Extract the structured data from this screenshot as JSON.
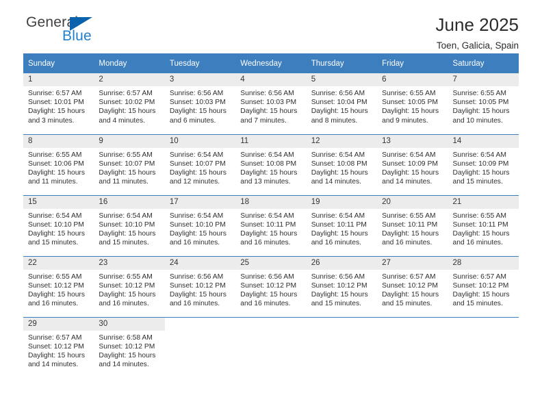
{
  "logo": {
    "primary_text": "General",
    "secondary_text": "Blue",
    "primary_color": "#404040",
    "secondary_color": "#1f7fd0",
    "triangle_color": "#0a62ad",
    "icon": "triangle-icon"
  },
  "header": {
    "title": "June 2025",
    "subtitle": "Toen, Galicia, Spain"
  },
  "theme": {
    "header_bg": "#3d7ebe",
    "header_text": "#ffffff",
    "daynum_bg": "#ececec",
    "divider": "#3d7ebe"
  },
  "calendar": {
    "weekday_headers": [
      "Sunday",
      "Monday",
      "Tuesday",
      "Wednesday",
      "Thursday",
      "Friday",
      "Saturday"
    ],
    "weeks": [
      [
        {
          "day": "1",
          "sunrise": "Sunrise: 6:57 AM",
          "sunset": "Sunset: 10:01 PM",
          "daylight": "Daylight: 15 hours and 3 minutes."
        },
        {
          "day": "2",
          "sunrise": "Sunrise: 6:57 AM",
          "sunset": "Sunset: 10:02 PM",
          "daylight": "Daylight: 15 hours and 4 minutes."
        },
        {
          "day": "3",
          "sunrise": "Sunrise: 6:56 AM",
          "sunset": "Sunset: 10:03 PM",
          "daylight": "Daylight: 15 hours and 6 minutes."
        },
        {
          "day": "4",
          "sunrise": "Sunrise: 6:56 AM",
          "sunset": "Sunset: 10:03 PM",
          "daylight": "Daylight: 15 hours and 7 minutes."
        },
        {
          "day": "5",
          "sunrise": "Sunrise: 6:56 AM",
          "sunset": "Sunset: 10:04 PM",
          "daylight": "Daylight: 15 hours and 8 minutes."
        },
        {
          "day": "6",
          "sunrise": "Sunrise: 6:55 AM",
          "sunset": "Sunset: 10:05 PM",
          "daylight": "Daylight: 15 hours and 9 minutes."
        },
        {
          "day": "7",
          "sunrise": "Sunrise: 6:55 AM",
          "sunset": "Sunset: 10:05 PM",
          "daylight": "Daylight: 15 hours and 10 minutes."
        }
      ],
      [
        {
          "day": "8",
          "sunrise": "Sunrise: 6:55 AM",
          "sunset": "Sunset: 10:06 PM",
          "daylight": "Daylight: 15 hours and 11 minutes."
        },
        {
          "day": "9",
          "sunrise": "Sunrise: 6:55 AM",
          "sunset": "Sunset: 10:07 PM",
          "daylight": "Daylight: 15 hours and 11 minutes."
        },
        {
          "day": "10",
          "sunrise": "Sunrise: 6:54 AM",
          "sunset": "Sunset: 10:07 PM",
          "daylight": "Daylight: 15 hours and 12 minutes."
        },
        {
          "day": "11",
          "sunrise": "Sunrise: 6:54 AM",
          "sunset": "Sunset: 10:08 PM",
          "daylight": "Daylight: 15 hours and 13 minutes."
        },
        {
          "day": "12",
          "sunrise": "Sunrise: 6:54 AM",
          "sunset": "Sunset: 10:08 PM",
          "daylight": "Daylight: 15 hours and 14 minutes."
        },
        {
          "day": "13",
          "sunrise": "Sunrise: 6:54 AM",
          "sunset": "Sunset: 10:09 PM",
          "daylight": "Daylight: 15 hours and 14 minutes."
        },
        {
          "day": "14",
          "sunrise": "Sunrise: 6:54 AM",
          "sunset": "Sunset: 10:09 PM",
          "daylight": "Daylight: 15 hours and 15 minutes."
        }
      ],
      [
        {
          "day": "15",
          "sunrise": "Sunrise: 6:54 AM",
          "sunset": "Sunset: 10:10 PM",
          "daylight": "Daylight: 15 hours and 15 minutes."
        },
        {
          "day": "16",
          "sunrise": "Sunrise: 6:54 AM",
          "sunset": "Sunset: 10:10 PM",
          "daylight": "Daylight: 15 hours and 15 minutes."
        },
        {
          "day": "17",
          "sunrise": "Sunrise: 6:54 AM",
          "sunset": "Sunset: 10:10 PM",
          "daylight": "Daylight: 15 hours and 16 minutes."
        },
        {
          "day": "18",
          "sunrise": "Sunrise: 6:54 AM",
          "sunset": "Sunset: 10:11 PM",
          "daylight": "Daylight: 15 hours and 16 minutes."
        },
        {
          "day": "19",
          "sunrise": "Sunrise: 6:54 AM",
          "sunset": "Sunset: 10:11 PM",
          "daylight": "Daylight: 15 hours and 16 minutes."
        },
        {
          "day": "20",
          "sunrise": "Sunrise: 6:55 AM",
          "sunset": "Sunset: 10:11 PM",
          "daylight": "Daylight: 15 hours and 16 minutes."
        },
        {
          "day": "21",
          "sunrise": "Sunrise: 6:55 AM",
          "sunset": "Sunset: 10:11 PM",
          "daylight": "Daylight: 15 hours and 16 minutes."
        }
      ],
      [
        {
          "day": "22",
          "sunrise": "Sunrise: 6:55 AM",
          "sunset": "Sunset: 10:12 PM",
          "daylight": "Daylight: 15 hours and 16 minutes."
        },
        {
          "day": "23",
          "sunrise": "Sunrise: 6:55 AM",
          "sunset": "Sunset: 10:12 PM",
          "daylight": "Daylight: 15 hours and 16 minutes."
        },
        {
          "day": "24",
          "sunrise": "Sunrise: 6:56 AM",
          "sunset": "Sunset: 10:12 PM",
          "daylight": "Daylight: 15 hours and 16 minutes."
        },
        {
          "day": "25",
          "sunrise": "Sunrise: 6:56 AM",
          "sunset": "Sunset: 10:12 PM",
          "daylight": "Daylight: 15 hours and 16 minutes."
        },
        {
          "day": "26",
          "sunrise": "Sunrise: 6:56 AM",
          "sunset": "Sunset: 10:12 PM",
          "daylight": "Daylight: 15 hours and 15 minutes."
        },
        {
          "day": "27",
          "sunrise": "Sunrise: 6:57 AM",
          "sunset": "Sunset: 10:12 PM",
          "daylight": "Daylight: 15 hours and 15 minutes."
        },
        {
          "day": "28",
          "sunrise": "Sunrise: 6:57 AM",
          "sunset": "Sunset: 10:12 PM",
          "daylight": "Daylight: 15 hours and 15 minutes."
        }
      ],
      [
        {
          "day": "29",
          "sunrise": "Sunrise: 6:57 AM",
          "sunset": "Sunset: 10:12 PM",
          "daylight": "Daylight: 15 hours and 14 minutes."
        },
        {
          "day": "30",
          "sunrise": "Sunrise: 6:58 AM",
          "sunset": "Sunset: 10:12 PM",
          "daylight": "Daylight: 15 hours and 14 minutes."
        },
        {
          "day": "",
          "sunrise": "",
          "sunset": "",
          "daylight": ""
        },
        {
          "day": "",
          "sunrise": "",
          "sunset": "",
          "daylight": ""
        },
        {
          "day": "",
          "sunrise": "",
          "sunset": "",
          "daylight": ""
        },
        {
          "day": "",
          "sunrise": "",
          "sunset": "",
          "daylight": ""
        },
        {
          "day": "",
          "sunrise": "",
          "sunset": "",
          "daylight": ""
        }
      ]
    ]
  }
}
